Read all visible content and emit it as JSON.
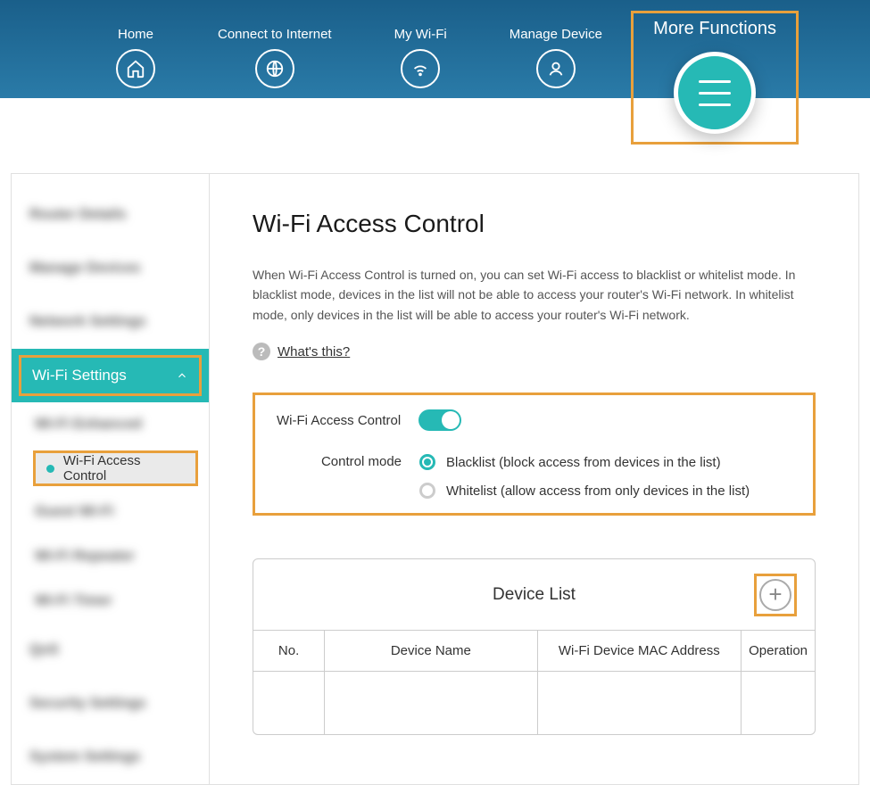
{
  "nav": [
    {
      "label": "Home",
      "icon": "home"
    },
    {
      "label": "Connect to Internet",
      "icon": "globe"
    },
    {
      "label": "My Wi-Fi",
      "icon": "wifi"
    },
    {
      "label": "Manage Device",
      "icon": "user"
    }
  ],
  "more_functions": {
    "label": "More Functions"
  },
  "sidebar": {
    "wifi_settings": "Wi-Fi Settings",
    "wifi_access_control": "Wi-Fi Access Control"
  },
  "main": {
    "title": "Wi-Fi Access Control",
    "description": "When Wi-Fi Access Control is turned on, you can set Wi-Fi access to blacklist or whitelist mode. In blacklist mode, devices in the list will not be able to access your router's Wi-Fi network. In whitelist mode, only devices in the list will be able to access your router's Wi-Fi network.",
    "whats_this": "What's this?",
    "toggle_label": "Wi-Fi Access Control",
    "toggle_on": true,
    "control_mode_label": "Control mode",
    "modes": {
      "blacklist": "Blacklist (block access from devices in the list)",
      "whitelist": "Whitelist (allow access from only devices in the list)"
    },
    "selected_mode": "blacklist"
  },
  "device_list": {
    "title": "Device List",
    "columns": {
      "no": "No.",
      "name": "Device Name",
      "mac": "Wi-Fi Device MAC Address",
      "op": "Operation"
    },
    "rows": []
  }
}
